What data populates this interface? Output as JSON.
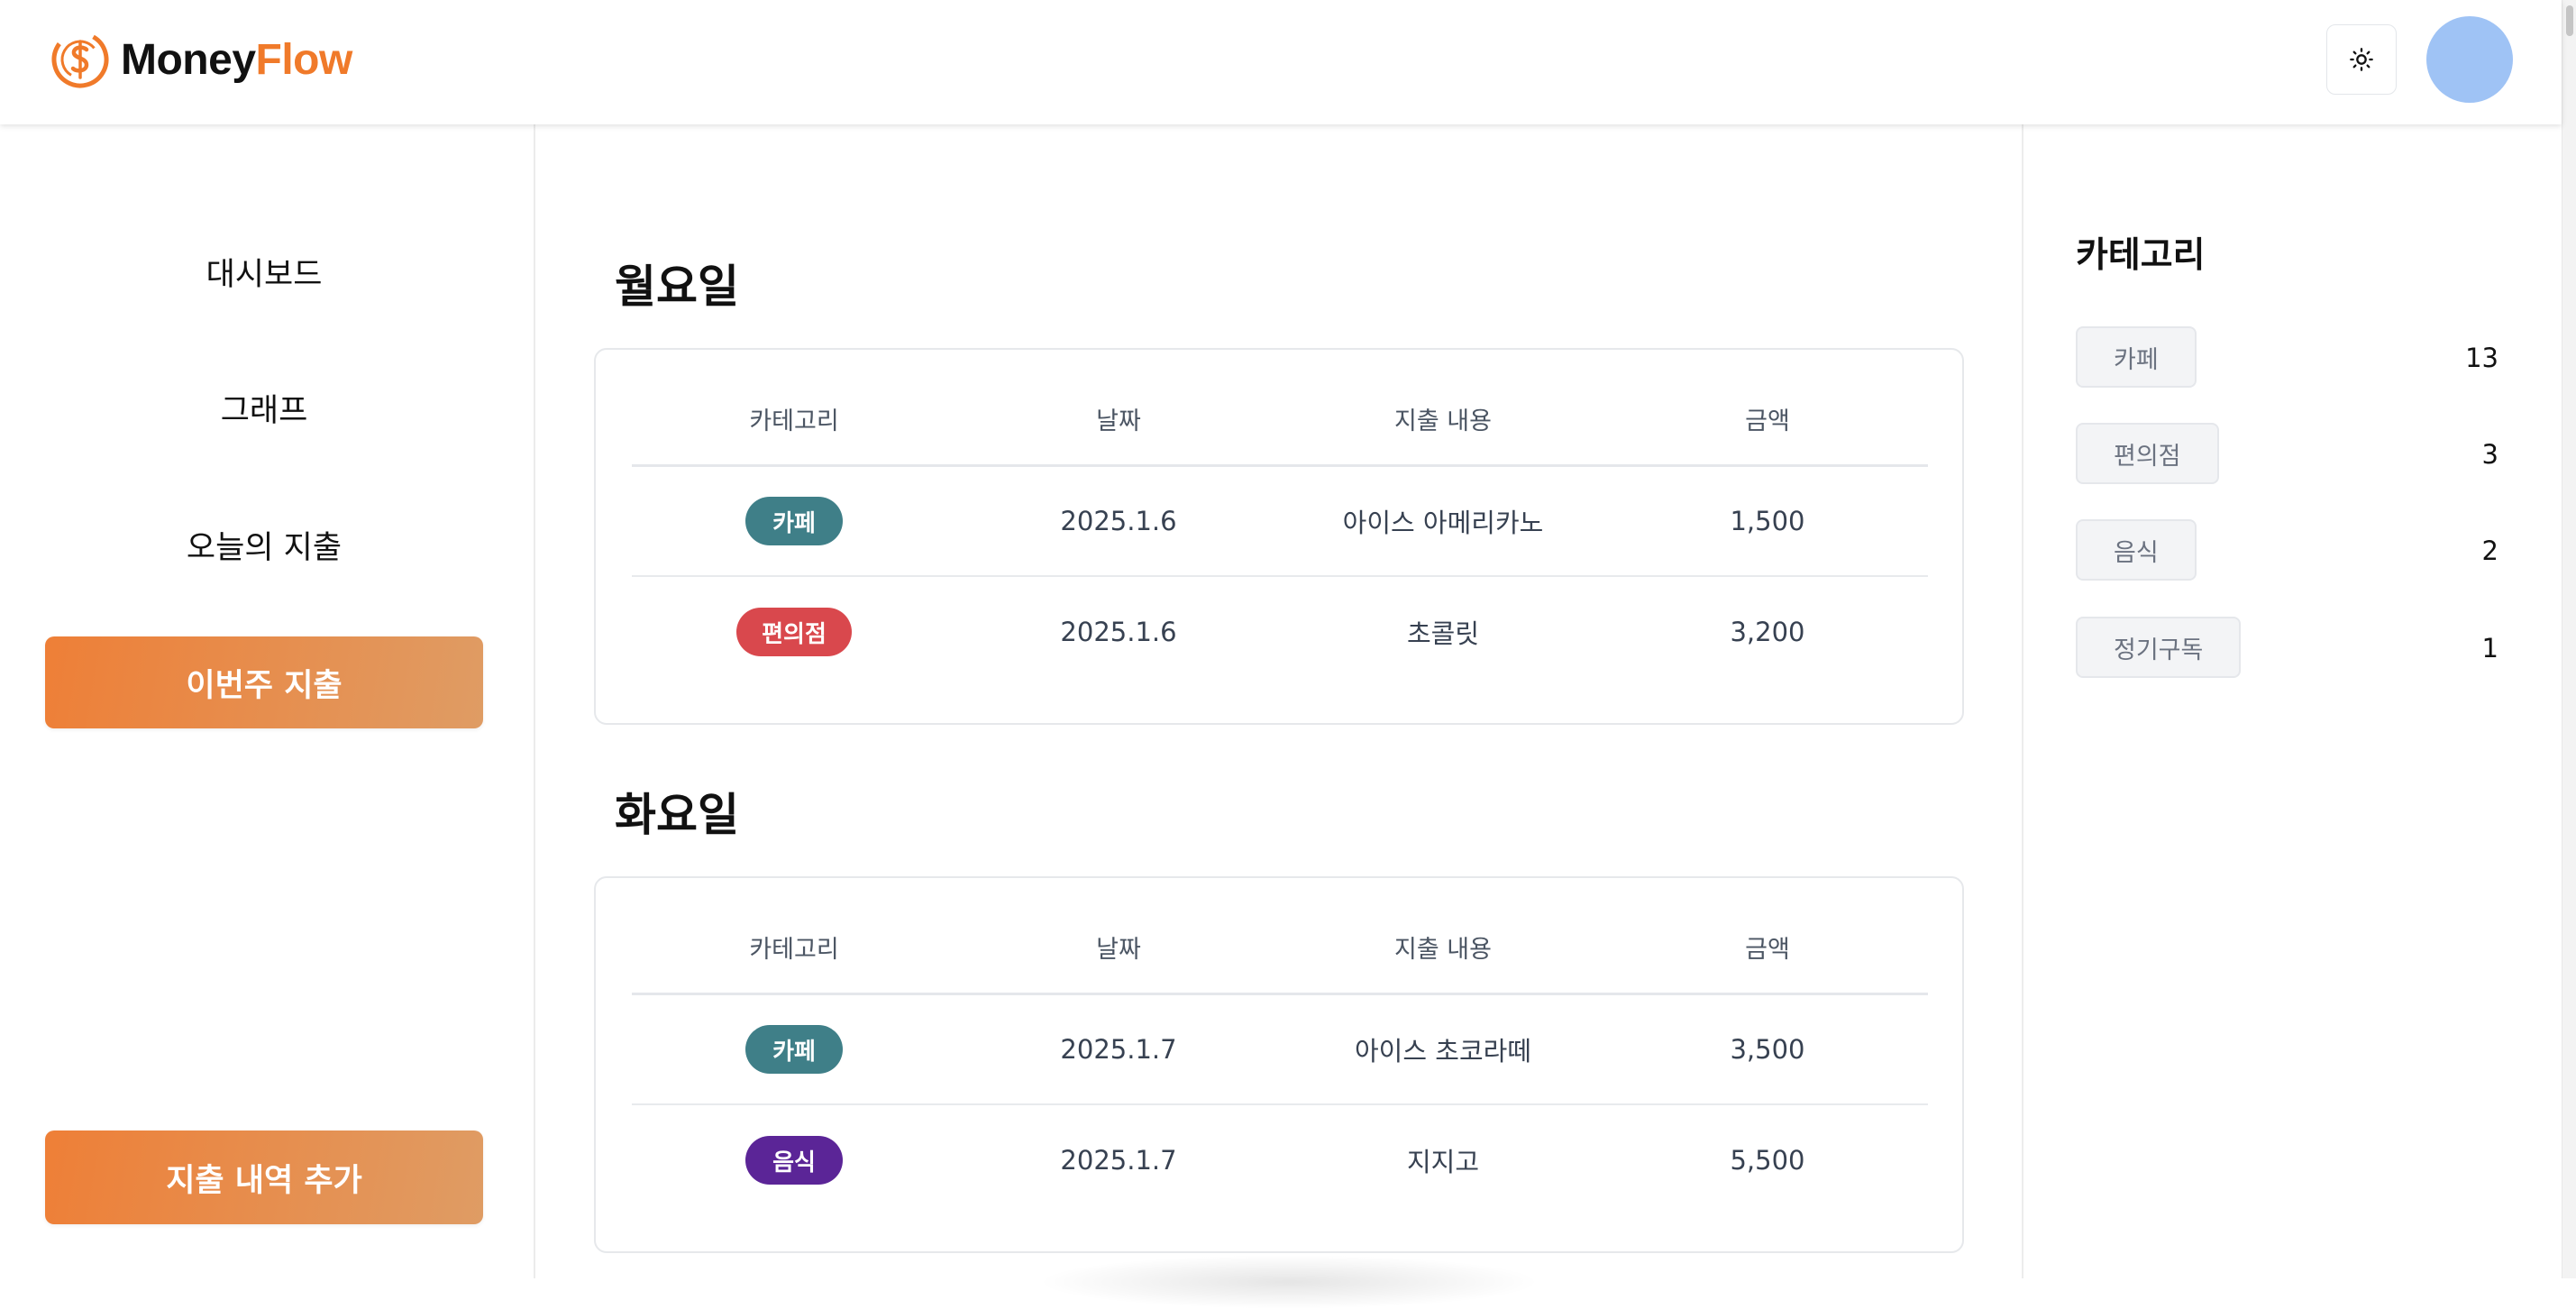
{
  "app": {
    "brand_part1": "Money",
    "brand_part2": "Flow",
    "brand_color": "#f07a2a"
  },
  "header": {
    "theme_icon": "sun-icon",
    "avatar_color": "#9fc3f5"
  },
  "sidebar": {
    "items": [
      {
        "label": "대시보드"
      },
      {
        "label": "그래프"
      },
      {
        "label": "오늘의 지출"
      },
      {
        "label": "이번주 지출",
        "active": true
      }
    ],
    "add_button": "지출 내역 추가"
  },
  "table_headers": {
    "category": "카테고리",
    "date": "날짜",
    "description": "지출 내용",
    "amount": "금액"
  },
  "days": [
    {
      "title": "월요일",
      "rows": [
        {
          "category": "카페",
          "category_color": "#3f7f88",
          "date": "2025.1.6",
          "description": "아이스 아메리카노",
          "amount": "1,500"
        },
        {
          "category": "편의점",
          "category_color": "#d9484d",
          "date": "2025.1.6",
          "description": "초콜릿",
          "amount": "3,200"
        }
      ]
    },
    {
      "title": "화요일",
      "rows": [
        {
          "category": "카페",
          "category_color": "#3f7f88",
          "date": "2025.1.7",
          "description": "아이스 초코라떼",
          "amount": "3,500"
        },
        {
          "category": "음식",
          "category_color": "#5b2597",
          "date": "2025.1.7",
          "description": "지지고",
          "amount": "5,500"
        }
      ]
    }
  ],
  "category_panel": {
    "title": "카테고리",
    "items": [
      {
        "label": "카페",
        "count": "13"
      },
      {
        "label": "편의점",
        "count": "3"
      },
      {
        "label": "음식",
        "count": "2"
      },
      {
        "label": "정기구독",
        "count": "1"
      }
    ]
  }
}
